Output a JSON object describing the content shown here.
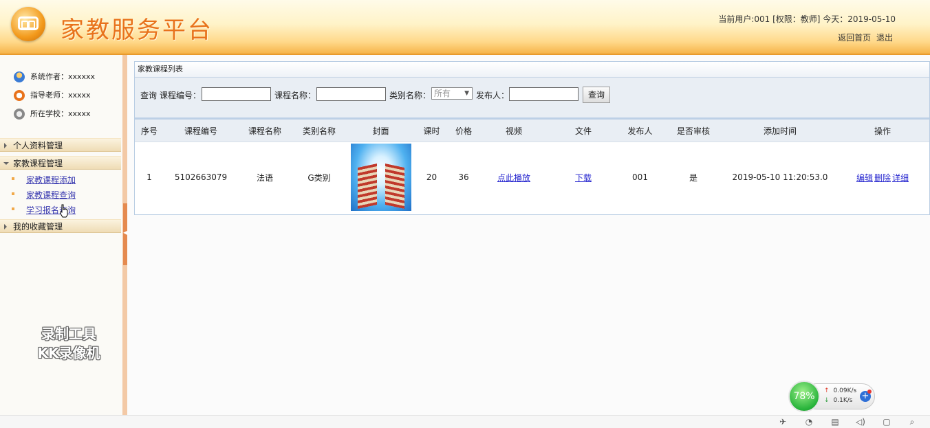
{
  "header": {
    "title": "家教服务平台",
    "user_line": "当前用户:001 [权限：教师] 今天：2019-05-10",
    "links": [
      "返回首页",
      "退出"
    ]
  },
  "sidebar": {
    "info": [
      {
        "icon": "user-group-icon",
        "text": "系统作者：xxxxxx"
      },
      {
        "icon": "alarm-clock-icon",
        "text": "指导老师：xxxxx"
      },
      {
        "icon": "globe-icon",
        "text": "所在学校：xxxxx"
      }
    ],
    "menus": [
      {
        "label": "个人资料管理",
        "open": false
      },
      {
        "label": "家教课程管理",
        "open": true,
        "items": [
          "家教课程添加",
          "家教课程查询",
          "学习报名查询"
        ]
      },
      {
        "label": "我的收藏管理",
        "open": false
      }
    ],
    "watermark": [
      "录制工具",
      "KK录像机"
    ]
  },
  "panel": {
    "title": "家教课程列表",
    "search": {
      "prefix": "查询",
      "course_no_label": "课程编号：",
      "course_name_label": "课程名称：",
      "category_label": "类别名称：",
      "category_value": "所有",
      "publisher_label": "发布人：",
      "button": "查询"
    },
    "table": {
      "headers": [
        "序号",
        "课程编号",
        "课程名称",
        "类别名称",
        "封面",
        "课时",
        "价格",
        "视频",
        "文件",
        "发布人",
        "是否审核",
        "添加时间",
        "操作"
      ],
      "rows": [
        {
          "index": "1",
          "course_no": "5102663079",
          "course_name": "法语",
          "category": "G类别",
          "hours": "20",
          "price": "36",
          "video": "点此播放",
          "file": "下载",
          "publisher": "001",
          "approved": "是",
          "added": "2019-05-10 11:20:53.0",
          "ops": [
            "编辑",
            "删除",
            "详细"
          ]
        }
      ]
    }
  },
  "widget": {
    "percent": "78%",
    "up": "0.09K/s",
    "down": "0.1K/s"
  },
  "colors": {
    "title": "#e8721b",
    "link": "#2a2ad0",
    "header_bottom": "#f6b44a"
  }
}
